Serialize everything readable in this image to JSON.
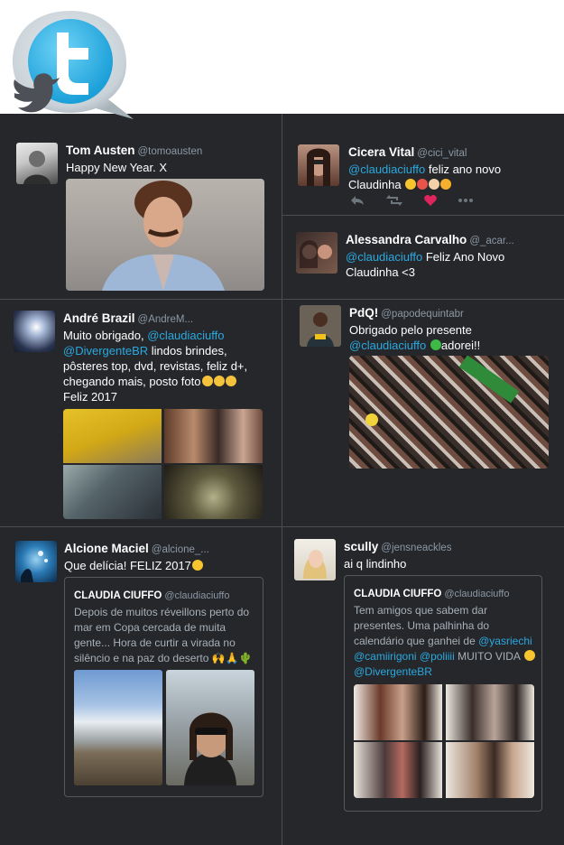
{
  "colors": {
    "background": "#25272b",
    "mention": "#2aa9e0",
    "like": "#e0245e",
    "handle": "#8b98a5"
  },
  "logo": {
    "icon": "twitter-bird-speech-bubble-icon"
  },
  "tweets": [
    {
      "name": "Tom Austen",
      "handle": "@tomoausten",
      "text": "Happy New Year. X",
      "media": "man-with-mustache-gif"
    },
    {
      "name": "Cicera Vital",
      "handle": "@cici_vital",
      "mention": "@claudiaciuffo",
      "text_a": " feliz ano novo",
      "text_b": "Claudinha ",
      "emoji": [
        "heart-eyes-emoji",
        "party-emoji",
        "clap-emoji",
        "kiss-emoji"
      ],
      "actions": [
        "reply-icon",
        "retweet-icon",
        "like-icon",
        "more-icon"
      ]
    },
    {
      "name": "Alessandra Carvalho",
      "handle": "@_acar...",
      "mention": "@claudiaciuffo",
      "text_a": " Feliz Ano Novo",
      "text_b": "Claudinha <3"
    },
    {
      "name": "André Brazil",
      "handle": "@AndreM...",
      "line1": "Muito obrigado, ",
      "mention1": "@claudiaciuffo",
      "mention2": "@DivergenteBR",
      "line2": " lindos brindes,",
      "line3": "pôsteres top, dvd, revistas, feliz d+,",
      "line4": "chegando mais, posto foto",
      "line5": "Feliz 2017",
      "emoji": [
        "clap-emoji",
        "clap-emoji",
        "clap-emoji"
      ]
    },
    {
      "name": "PdQ!",
      "handle": "@papodequintabr",
      "line1": "Obrigado pelo presente",
      "mention": "@claudiaciuffo",
      "line2": "adorei!!",
      "emoji": [
        "green-heart-emoji"
      ]
    },
    {
      "name": "Alcione Maciel",
      "handle": "@alcione_...",
      "text": "Que delícia! FELIZ 2017",
      "emoji": [
        "wink-emoji"
      ],
      "quote": {
        "name": "CLAUDIA CIUFFO",
        "handle": "@claudiaciuffo",
        "lines": [
          "Depois de muitos réveillons perto do",
          "mar em Copa cercada de muita",
          "gente... Hora de curtir a virada no",
          "silêncio e na paz do deserto 🙌🙏🌵"
        ]
      }
    },
    {
      "name": "scully",
      "handle": "@jensneackles",
      "text": "ai q lindinho",
      "quote": {
        "name": "CLAUDIA CIUFFO",
        "handle": "@claudiaciuffo",
        "line1": "Tem amigos que sabem dar",
        "line2": "presentes. Uma palhinha do",
        "line3": "calendário que ganhei de ",
        "m1": "@yasriechi",
        "m2": "@camiirigoni",
        "m3": "@poliiii",
        "line4": " MUITO VIDA ",
        "m4": "@DivergenteBR"
      }
    }
  ]
}
